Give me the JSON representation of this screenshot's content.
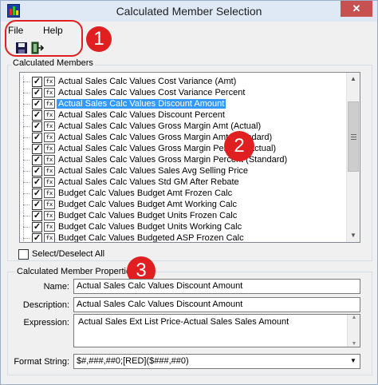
{
  "window": {
    "title": "Calculated Member Selection",
    "close_label": "✕"
  },
  "menu": {
    "file": "File",
    "help": "Help"
  },
  "callouts": [
    "1",
    "2",
    "3"
  ],
  "calculated_members": {
    "group_label": "Calculated Members",
    "items": [
      {
        "label": "Actual Sales Calc Values Cost Variance (Amt)",
        "checked": true
      },
      {
        "label": "Actual Sales Calc Values Cost Variance Percent",
        "checked": true
      },
      {
        "label": "Actual Sales Calc Values Discount Amount",
        "checked": true,
        "selected": true
      },
      {
        "label": "Actual Sales Calc Values Discount Percent",
        "checked": true
      },
      {
        "label": "Actual Sales Calc Values Gross Margin Amt (Actual)",
        "checked": true
      },
      {
        "label": "Actual Sales Calc Values Gross Margin Amt (Standard)",
        "checked": true
      },
      {
        "label": "Actual Sales Calc Values Gross Margin Percent (Actual)",
        "checked": true
      },
      {
        "label": "Actual Sales Calc Values Gross Margin Percent (Standard)",
        "checked": true
      },
      {
        "label": "Actual Sales Calc Values Sales Avg Selling Price",
        "checked": true
      },
      {
        "label": "Actual Sales Calc Values Std GM After Rebate",
        "checked": true
      },
      {
        "label": "Budget Calc Values Budget Amt Frozen Calc",
        "checked": true
      },
      {
        "label": "Budget Calc Values Budget Amt Working Calc",
        "checked": true
      },
      {
        "label": "Budget Calc Values Budget Units Frozen Calc",
        "checked": true
      },
      {
        "label": "Budget Calc Values Budget Units Working Calc",
        "checked": true
      },
      {
        "label": "Budget Calc Values Budgeted ASP Frozen Calc",
        "checked": true
      }
    ],
    "item_icon_text": "fx",
    "select_all_label": "Select/Deselect All"
  },
  "properties": {
    "group_label": "Calculated Member Properties",
    "name_label": "Name:",
    "name_value": "Actual Sales Calc Values Discount Amount",
    "description_label": "Description:",
    "description_value": "Actual Sales Calc Values Discount Amount",
    "expression_label": "Expression:",
    "expression_value": "Actual Sales Ext List Price-Actual Sales Sales Amount",
    "format_label": "Format String:",
    "format_value": "$#,###,##0;[RED]($###,##0)"
  },
  "colors": {
    "accent": "#3399ff",
    "callout": "#e02020",
    "close": "#c75050"
  }
}
